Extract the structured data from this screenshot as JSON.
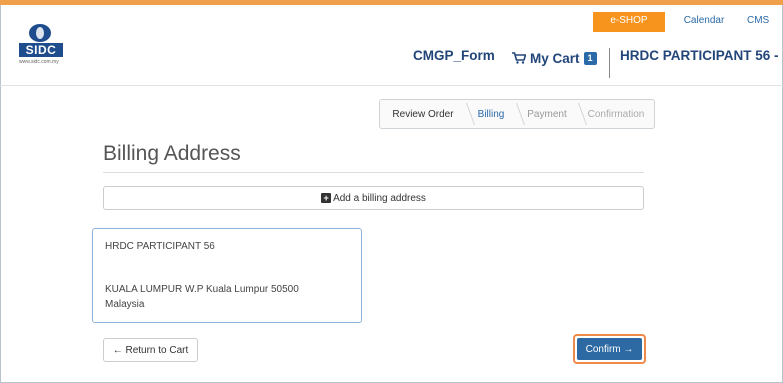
{
  "topnav": {
    "eshop": "e-SHOP",
    "calendar": "Calendar",
    "cms": "CMS"
  },
  "logo": {
    "text": "SIDC",
    "url": "www.sidc.com.my"
  },
  "header": {
    "form_link": "CMGP_Form",
    "cart_label": "My Cart",
    "cart_count": "1",
    "user": "HRDC PARTICIPANT 56 -"
  },
  "steps": [
    "Review Order",
    "Billing",
    "Payment",
    "Confirmation"
  ],
  "page_title": "Billing Address",
  "add_billing_label": "Add a billing address",
  "address": {
    "name": "HRDC PARTICIPANT 56",
    "line1": "KUALA LUMPUR W.P Kuala Lumpur 50500",
    "line2": "Malaysia"
  },
  "buttons": {
    "return": "← Return to Cart",
    "confirm": "Confirm →"
  },
  "colors": {
    "accent": "#f7941d",
    "primary": "#2d6aa3",
    "brand": "#1e4c8c"
  }
}
